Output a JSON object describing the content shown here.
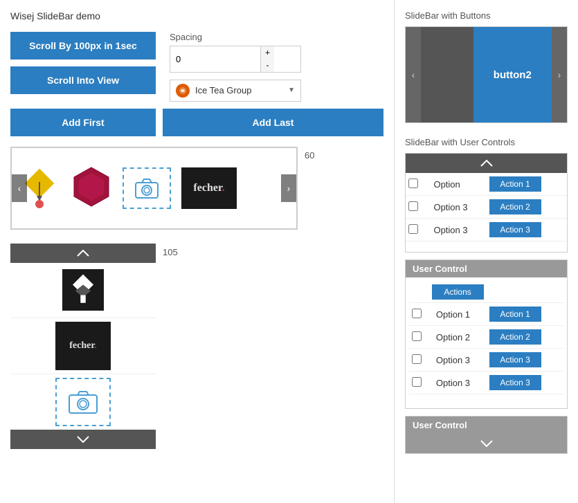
{
  "page": {
    "title": "Wisej SlideBar demo"
  },
  "left": {
    "btn_scroll": "Scroll By 100px in 1sec",
    "btn_scroll_view": "Scroll Into View",
    "btn_add_first": "Add First",
    "btn_add_last": "Add Last",
    "spacing_label": "Spacing",
    "spacing_value": "0",
    "spacing_plus": "+",
    "spacing_minus": "-",
    "dropdown_text": "Ice Tea Group",
    "carousel_count": "60",
    "vertical_count": "105"
  },
  "right": {
    "slidebar_buttons_title": "SlideBar with Buttons",
    "button2_label": "button2",
    "slidebar_user_title": "SlideBar with User Controls",
    "user_control_label": "User Control",
    "actions_label": "Actions",
    "options": [
      "Option 1",
      "Option 2",
      "Option 3",
      "Option 3"
    ],
    "options_top": [
      "Option",
      "Option 3",
      "Option 3"
    ],
    "actions_top": [
      "Action 1",
      "Action 2",
      "Action 3"
    ],
    "action1": "Action 1",
    "action2": "Action 2",
    "action3": "Action 3",
    "fecher_text": "fecher.",
    "fecher_dot_color": "#c0392b"
  }
}
